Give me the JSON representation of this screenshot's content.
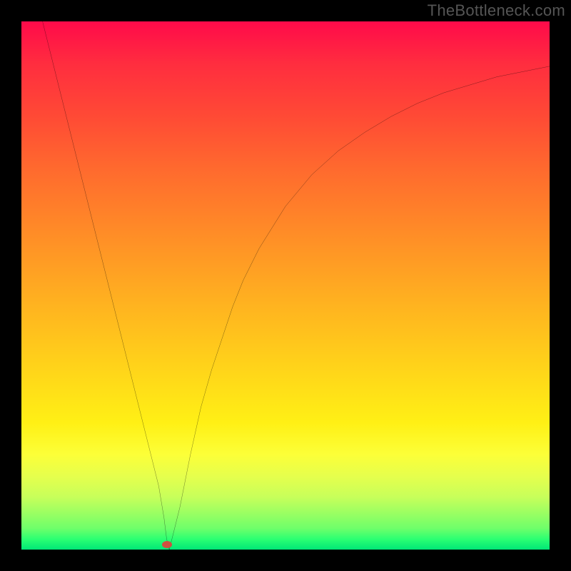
{
  "watermark": "TheBottleneck.com",
  "chart_data": {
    "type": "line",
    "title": "",
    "xlabel": "",
    "ylabel": "",
    "xlim": [
      0,
      100
    ],
    "ylim": [
      0,
      100
    ],
    "grid": false,
    "series": [
      {
        "name": "curve",
        "x": [
          4,
          8,
          12,
          16,
          20,
          22,
          24,
          26,
          27,
          27.5,
          28,
          30,
          32,
          34,
          36,
          38,
          40,
          42,
          45,
          50,
          55,
          60,
          65,
          70,
          75,
          80,
          85,
          90,
          95,
          100
        ],
        "y": [
          100,
          84,
          68,
          52,
          36,
          28,
          20,
          12,
          6,
          2,
          0,
          8,
          18,
          27,
          34,
          40,
          46,
          51,
          57,
          65,
          71,
          75.5,
          79,
          82,
          84.5,
          86.5,
          88,
          89.5,
          90.5,
          91.5
        ]
      }
    ],
    "marker": {
      "x": 27.5,
      "y": 1,
      "color": "#d05040"
    },
    "background": {
      "type": "vertical-gradient",
      "stops": [
        {
          "pos": 0,
          "color": "#ff0a4a"
        },
        {
          "pos": 50,
          "color": "#ffb120"
        },
        {
          "pos": 80,
          "color": "#fff015"
        },
        {
          "pos": 100,
          "color": "#00e676"
        }
      ]
    }
  }
}
